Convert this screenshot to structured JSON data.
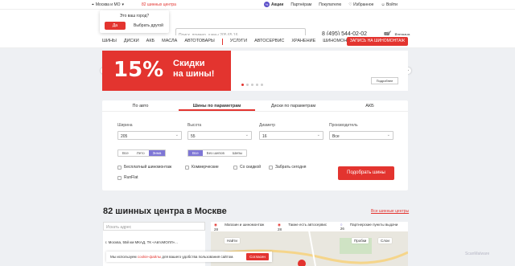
{
  "topbar": {
    "city": "Москва и МО",
    "centers": "82 шинных центра",
    "promo": "Акции",
    "partners": "Партнёрам",
    "buyers": "Покупателю",
    "favorites": "Избранное",
    "login": "Войти"
  },
  "city_popup": {
    "question": "Это ваш город?",
    "yes": "Да",
    "other": "Выбрать другой"
  },
  "header": {
    "search_placeholder": "Поиск, пример, шины 205 65 16",
    "phone": "8 (495) 544-02-02",
    "cart": "Корзина"
  },
  "nav": {
    "items": [
      "ШИНЫ",
      "ДИСКИ",
      "АКБ",
      "МАСЛА",
      "АВТОТОВАРЫ"
    ],
    "items2": [
      "УСЛУГИ",
      "АВТОСЕРВИС",
      "ХРАНЕНИЕ",
      "ШИНОМОНТАЖ"
    ],
    "cta": "ЗАПИСЬ НА ШИНОМОНТАЖ"
  },
  "banner": {
    "percent": "15%",
    "line1": "Скидки",
    "line2": "на шины!",
    "more": "Подробнее"
  },
  "tabs": [
    "По авто",
    "Шины по параметрам",
    "Диски по параметрам",
    "АКБ"
  ],
  "filters": {
    "width_label": "Ширина",
    "width": "205",
    "height_label": "Высота",
    "height": "55",
    "diameter_label": "Диаметр",
    "diameter": "16",
    "maker_label": "Производитель",
    "maker": "Все"
  },
  "season": [
    "Все",
    "Лето",
    "Зима"
  ],
  "spikes": [
    "Все",
    "Без шипов",
    "Шипы"
  ],
  "options": [
    "Бесплатный шиномонтаж",
    "Коммерческие",
    "Со скидкой",
    "Забрать сегодня",
    "RunFlat"
  ],
  "pick_button": "Подобрать шины",
  "centers_title": "82 шинных центра в Москве",
  "all_centers": "Все шинные центры",
  "side": {
    "search_placeholder": "Искать адрес",
    "address": "г. Москва, 55й км МКАД, ТК «АвтоМОЛЛ»..."
  },
  "legend": [
    "Магазин и шиномонтаж 28",
    "Также есть автосервис 28",
    "Партнерские пункты выдачи 26"
  ],
  "map": {
    "find": "Найти",
    "layers": "Пробки",
    "layers2": "Слои"
  },
  "cookie": {
    "pre": "Мы используем ",
    "link": "cookie-файлы",
    "post": " для вашего удобства пользования сайтом.",
    "ok": "Согласен"
  },
  "watermark": "ScanMalware"
}
